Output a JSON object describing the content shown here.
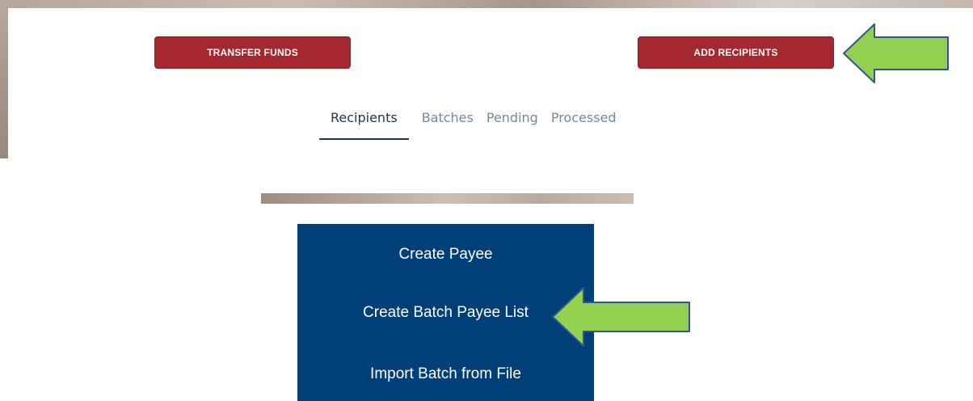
{
  "top_panel": {
    "buttons": {
      "transfer_funds": "TRANSFER FUNDS",
      "add_recipients": "ADD RECIPIENTS"
    },
    "tabs": [
      {
        "label": "Recipients",
        "active": true
      },
      {
        "label": "Batches",
        "active": false
      },
      {
        "label": "Pending",
        "active": false
      },
      {
        "label": "Processed",
        "active": false
      }
    ]
  },
  "menu": {
    "items": [
      {
        "label": "Create Payee"
      },
      {
        "label": "Create Batch Payee List"
      },
      {
        "label": "Import Batch from File"
      }
    ]
  },
  "annotations": {
    "arrow_color": "#92d050",
    "arrow_outline": "#2f5597"
  },
  "colors": {
    "button_red": "#a4282d",
    "menu_blue": "#003f78",
    "tab_active": "#1f3550",
    "tab_inactive": "#6e8aa6"
  }
}
